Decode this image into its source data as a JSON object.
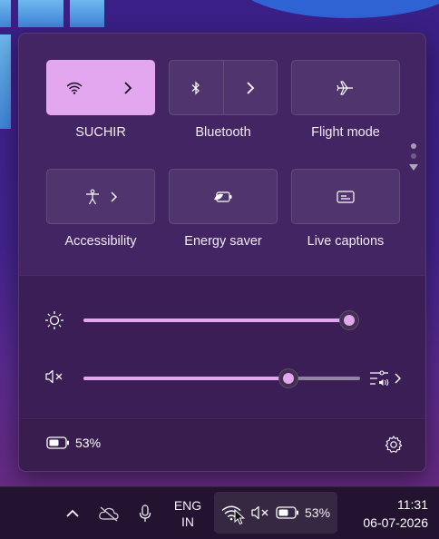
{
  "quick_settings": {
    "tiles": [
      {
        "id": "wifi",
        "label": "SUCHIR",
        "active": true,
        "split": true
      },
      {
        "id": "bluetooth",
        "label": "Bluetooth",
        "active": false,
        "split": true
      },
      {
        "id": "flight",
        "label": "Flight mode",
        "active": false,
        "split": false
      },
      {
        "id": "accessibility",
        "label": "Accessibility",
        "active": false,
        "split": false
      },
      {
        "id": "energy",
        "label": "Energy saver",
        "active": false,
        "split": false
      },
      {
        "id": "captions",
        "label": "Live captions",
        "active": false,
        "split": false
      }
    ],
    "brightness": {
      "value_percent": 100
    },
    "volume": {
      "value_percent": 74,
      "muted": true
    },
    "battery_label": "53%"
  },
  "taskbar": {
    "language_line1": "ENG",
    "language_line2": "IN",
    "battery_label": "53%",
    "time": "11:31",
    "date": "06-07-2026"
  },
  "colors": {
    "accent": "#e3a7ef",
    "flyout_bg": "#442660",
    "taskbar_bg": "#231330"
  },
  "icons": {
    "wifi": "wifi-icon",
    "bluetooth": "bluetooth-icon",
    "flight": "airplane-icon",
    "accessibility": "accessibility-icon",
    "energy": "energy-saver-icon",
    "captions": "captions-icon",
    "brightness": "sun-icon",
    "volume": "speaker-muted-icon",
    "settings": "gear-icon"
  }
}
